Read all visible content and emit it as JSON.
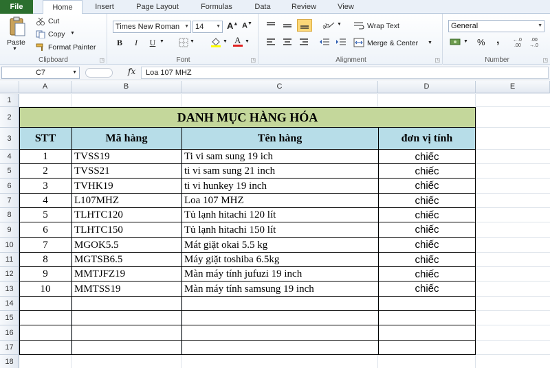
{
  "tabs": [
    "File",
    "Home",
    "Insert",
    "Page Layout",
    "Formulas",
    "Data",
    "Review",
    "View"
  ],
  "ribbon": {
    "clipboard": {
      "paste": "Paste",
      "cut": "Cut",
      "copy": "Copy",
      "format_painter": "Format Painter",
      "label": "Clipboard"
    },
    "font": {
      "name": "Times New Roman",
      "size": "14",
      "bold": "B",
      "italic": "I",
      "underline": "U",
      "label": "Font"
    },
    "alignment": {
      "wrap_text": "Wrap Text",
      "merge_center": "Merge & Center",
      "label": "Alignment"
    },
    "number": {
      "format": "General",
      "percent": "%",
      "comma": ",",
      "label": "Number"
    }
  },
  "formula_bar": {
    "name_box": "C7",
    "fx": "fx",
    "value": "Loa 107 MHZ"
  },
  "columns": [
    "A",
    "B",
    "C",
    "D",
    "E"
  ],
  "rows": [
    "1",
    "2",
    "3",
    "4",
    "5",
    "6",
    "7",
    "8",
    "9",
    "10",
    "11",
    "12",
    "13",
    "14",
    "15",
    "16",
    "17",
    "18"
  ],
  "sheet": {
    "title": "DANH MỤC HÀNG HÓA",
    "headers": [
      "STT",
      "Mã hàng",
      "Tên hàng",
      "đơn vị tính"
    ],
    "data": [
      [
        "1",
        "TVSS19",
        "Ti vi sam sung 19 ich",
        "chiếc"
      ],
      [
        "2",
        "TVSS21",
        "ti vi sam sung 21 inch",
        "chiếc"
      ],
      [
        "3",
        "TVHK19",
        "ti vi hunkey 19 inch",
        "chiếc"
      ],
      [
        "4",
        "L107MHZ",
        "Loa 107 MHZ",
        "chiếc"
      ],
      [
        "5",
        "TLHTC120",
        "Tủ lạnh hitachi 120 lít",
        "chiếc"
      ],
      [
        "6",
        "TLHTC150",
        "Tủ lạnh hitachi 150 lít",
        "chiếc"
      ],
      [
        "7",
        "MGOK5.5",
        "Mát giặt okai 5.5 kg",
        "chiếc"
      ],
      [
        "8",
        "MGTSB6.5",
        "Máy giặt toshiba 6.5kg",
        "chiếc"
      ],
      [
        "9",
        "MMTJFZ19",
        "Màn máy tính jufuzi 19 inch",
        "chiếc"
      ],
      [
        "10",
        "MMTSS19",
        "Màn máy tính samsung 19 inch",
        "chiếc"
      ]
    ]
  },
  "colors": {
    "title_fill": "#c4d79b",
    "header_fill": "#b7dde8",
    "file_tab": "#2c6f2e"
  }
}
